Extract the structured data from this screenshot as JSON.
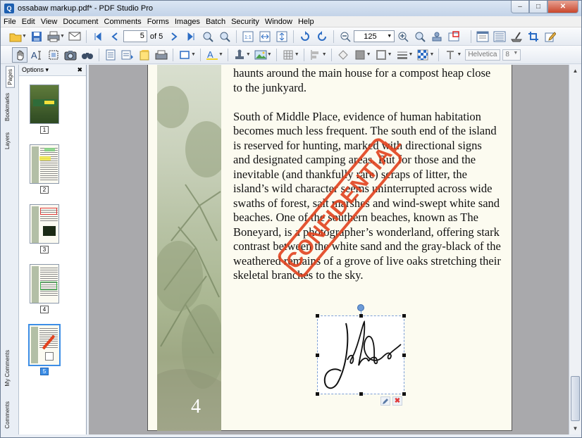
{
  "window": {
    "title": "ossabaw markup.pdf* - PDF Studio Pro",
    "app_icon": "Q",
    "minimize": "–",
    "maximize": "□",
    "close": "✕"
  },
  "menu": [
    "File",
    "Edit",
    "View",
    "Document",
    "Comments",
    "Forms",
    "Images",
    "Batch",
    "Security",
    "Window",
    "Help"
  ],
  "toolbar": {
    "page_current": "5",
    "page_of": "of 5",
    "zoom": "125",
    "font_name": "Helvetica",
    "font_size": "8"
  },
  "left_tabs": {
    "pages": "Pages",
    "bookmarks": "Bookmarks",
    "layers": "Layers",
    "my_comments": "My Comments",
    "comments": "Comments"
  },
  "panel": {
    "options_label": "Options ▾",
    "close": "✖",
    "thumbnails": [
      {
        "label": "1"
      },
      {
        "label": "2"
      },
      {
        "label": "3"
      },
      {
        "label": "4"
      },
      {
        "label": "5"
      }
    ],
    "selected_page": 5
  },
  "document": {
    "para1": "haunts around the main house for a compost heap close to the junkyard.",
    "para2": "South of Middle Place, evidence of human habitation becomes much less frequent. The south end of the island is reserved for hunting, marked with directional signs and designated camping areas. But for those and the inevitable (and thankfully rare) scraps of litter, the island’s wild character seems uninterrupted across wide swaths of forest, salt marshes and wind-swept white sand beaches. One of the southern beaches, known as The Boneyard, is a photographer’s wonderland, offering stark contrast between the white sand and the gray-black of the weathered remains of a grove of live oaks stretching their skeletal branches to the sky.",
    "page_number": "4",
    "stamp": "CONFIDENTIAL",
    "signature": "John Doe"
  },
  "colors": {
    "stamp": "#e2421e",
    "selection": "#3d8ee6",
    "viewer_bg": "#a9a9ac"
  }
}
